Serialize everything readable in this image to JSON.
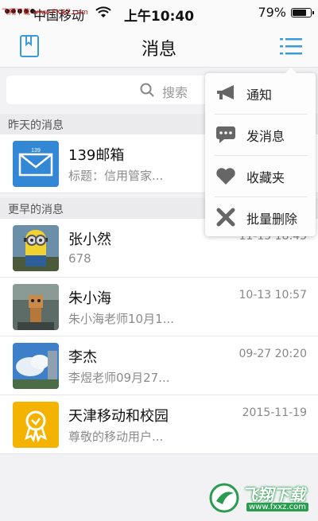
{
  "status_bar": {
    "watermark": "飞翔下载 www.FXXZ.com",
    "carrier": "中国移动",
    "time": "上午10:40",
    "battery_text": "79%",
    "battery_level": 0.79
  },
  "nav": {
    "title": "消息",
    "left_icon": "book-icon",
    "right_icon": "menu-list-icon",
    "accent": "#3a9bdc"
  },
  "search": {
    "placeholder": "搜索"
  },
  "sections": {
    "yesterday": "昨天的消息",
    "earlier": "更早的消息"
  },
  "conversations": [
    {
      "title": "139邮箱",
      "subtitle": "标题：信用管家...",
      "time": "",
      "avatar": "mail-icon"
    },
    {
      "title": "张小然",
      "subtitle": "678",
      "time": "11-15 18:45",
      "avatar": "minion-photo"
    },
    {
      "title": "朱小海",
      "subtitle": "朱小海老师10月1...",
      "time": "10-13 10:57",
      "avatar": "toy-photo"
    },
    {
      "title": "李杰",
      "subtitle": "李煜老师09月27...",
      "time": "09-27 20:20",
      "avatar": "sky-photo"
    },
    {
      "title": "天津移动和校园",
      "subtitle": "尊敬的移动用户...",
      "time": "2015-11-19",
      "avatar": "ribbon-badge-icon"
    }
  ],
  "menu": {
    "items": [
      {
        "label": "通知",
        "icon": "megaphone-icon"
      },
      {
        "label": "发消息",
        "icon": "chat-bubble-icon"
      },
      {
        "label": "收藏夹",
        "icon": "heart-icon"
      },
      {
        "label": "批量删除",
        "icon": "x-icon"
      }
    ]
  },
  "watermark_bottom": {
    "name": "飞翔下载",
    "url": "www.fxxz.com"
  }
}
